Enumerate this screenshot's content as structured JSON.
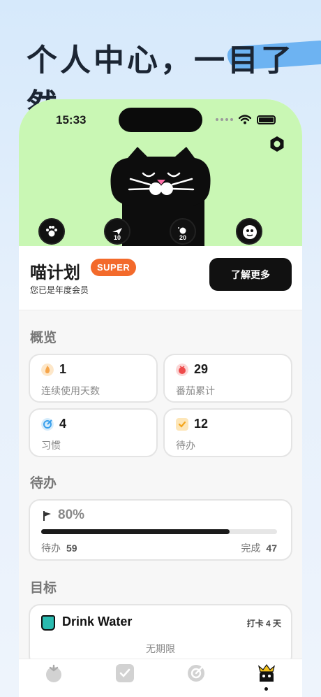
{
  "headline": "个人中心，一目了然",
  "status": {
    "time": "15:33"
  },
  "profile": {
    "name": "喵计划",
    "badge": "SUPER",
    "member_text": "您已是年度会员",
    "learn_more": "了解更多"
  },
  "badges": [
    {
      "icon": "paw-icon",
      "label": ""
    },
    {
      "icon": "plane-icon",
      "label": "10"
    },
    {
      "icon": "planet-icon",
      "label": "20"
    },
    {
      "icon": "cat-face-icon",
      "label": ""
    }
  ],
  "overview": {
    "title": "概览",
    "stats": [
      {
        "icon": "flame-icon",
        "value": "1",
        "label": "连续使用天数",
        "color": "#f6a54a"
      },
      {
        "icon": "tomato-icon",
        "value": "29",
        "label": "番茄累计",
        "color": "#ee4b4b"
      },
      {
        "icon": "habit-target-icon",
        "value": "4",
        "label": "习惯",
        "color": "#3aa0ec"
      },
      {
        "icon": "checkbox-icon",
        "value": "12",
        "label": "待办",
        "color": "#f4b93b"
      }
    ]
  },
  "todo": {
    "title": "待办",
    "percent_text": "80%",
    "progress": 0.8,
    "pending_label": "待办",
    "pending_count": "59",
    "done_label": "完成",
    "done_count": "47"
  },
  "goals": {
    "title": "目标",
    "items": [
      {
        "icon": "cup-icon",
        "name": "Drink Water",
        "checkin": "打卡 4 天",
        "deadline": "无期限"
      }
    ]
  },
  "tabs": [
    {
      "icon": "tomato-tab-icon",
      "active": false
    },
    {
      "icon": "todo-tab-icon",
      "active": false
    },
    {
      "icon": "habit-tab-icon",
      "active": false
    },
    {
      "icon": "profile-tab-icon",
      "active": true
    }
  ],
  "colors": {
    "hero_bg": "#c9f7b4",
    "accent": "#f36a2b",
    "dark": "#111111"
  }
}
